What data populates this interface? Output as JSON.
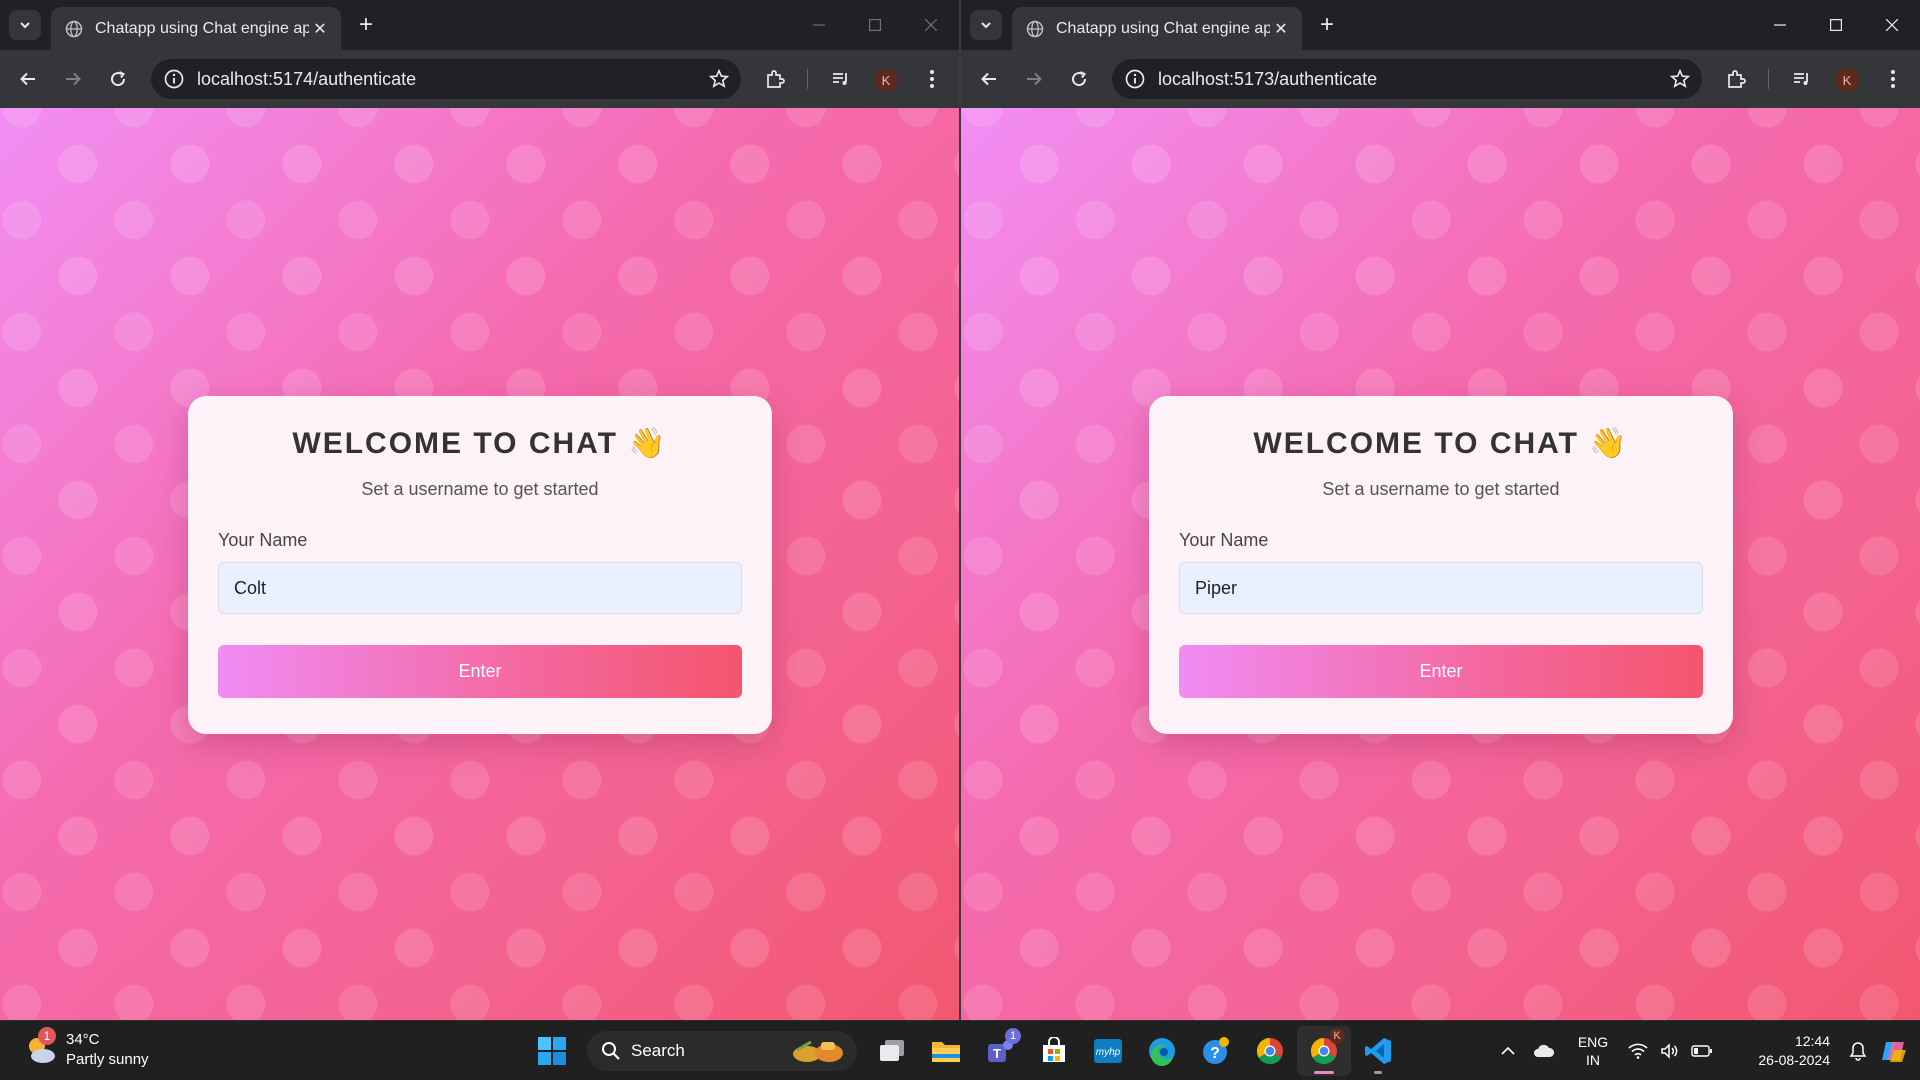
{
  "windows": {
    "left": {
      "tab_title": "Chatapp using Chat engine api",
      "url": "localhost:5174/authenticate",
      "avatar_letter": "K",
      "page": {
        "title": "WELCOME TO CHAT 👋",
        "subtitle": "Set a username to get started",
        "field_label": "Your Name",
        "field_value": "Colt",
        "button_label": "Enter"
      }
    },
    "right": {
      "tab_title": "Chatapp using Chat engine api",
      "url": "localhost:5173/authenticate",
      "avatar_letter": "K",
      "page": {
        "title": "WELCOME TO CHAT 👋",
        "subtitle": "Set a username to get started",
        "field_label": "Your Name",
        "field_value": "Piper",
        "button_label": "Enter"
      }
    }
  },
  "taskbar": {
    "weather": {
      "temp": "34°C",
      "condition": "Partly sunny",
      "badge": "1"
    },
    "search_label": "Search",
    "teams_badge": "1",
    "chrome_badge": "K",
    "language": {
      "line1": "ENG",
      "line2": "IN"
    },
    "clock": {
      "time": "12:44",
      "date": "26-08-2024"
    }
  },
  "colors": {
    "page_gradient": [
      "#f28ef5",
      "#f4618d",
      "#f2576f"
    ],
    "button_gradient": [
      "#f08cf4",
      "#f4556c"
    ],
    "card_bg": "#fdf2f8",
    "browser_chrome": "#35363a"
  }
}
